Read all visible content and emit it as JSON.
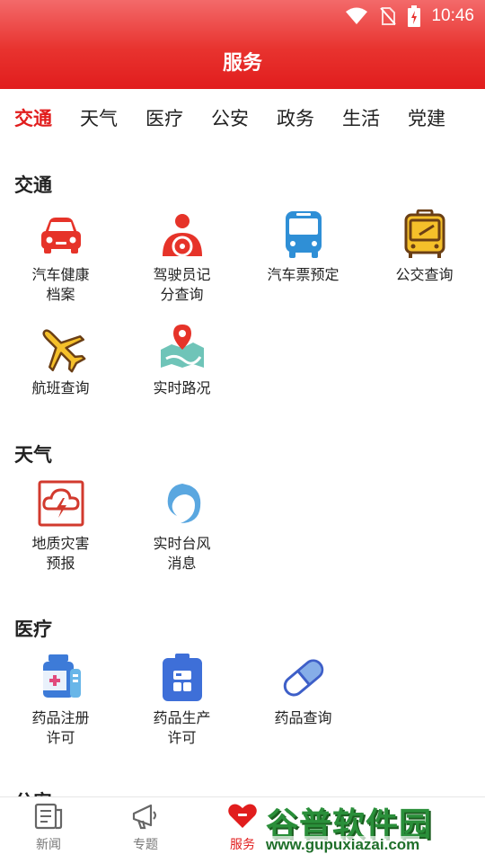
{
  "statusbar": {
    "time": "10:46"
  },
  "header": {
    "title": "服务"
  },
  "tabs": [
    {
      "label": "交通",
      "active": true
    },
    {
      "label": "天气"
    },
    {
      "label": "医疗"
    },
    {
      "label": "公安"
    },
    {
      "label": "政务"
    },
    {
      "label": "生活"
    },
    {
      "label": "党建"
    }
  ],
  "sections": {
    "traffic": {
      "title": "交通",
      "items": [
        {
          "label": "汽车健康\n档案",
          "icon": "car-icon"
        },
        {
          "label": "驾驶员记\n分查询",
          "icon": "driver-icon"
        },
        {
          "label": "汽车票预定",
          "icon": "bus-icon"
        },
        {
          "label": "公交查询",
          "icon": "bus-front-icon"
        },
        {
          "label": "航班查询",
          "icon": "airplane-icon"
        },
        {
          "label": "实时路况",
          "icon": "map-pin-icon"
        }
      ]
    },
    "weather": {
      "title": "天气",
      "items": [
        {
          "label": "地质灾害\n预报",
          "icon": "storm-warning-icon"
        },
        {
          "label": "实时台风\n消息",
          "icon": "typhoon-icon"
        }
      ]
    },
    "medical": {
      "title": "医疗",
      "items": [
        {
          "label": "药品注册\n许可",
          "icon": "medicine-bottle-icon"
        },
        {
          "label": "药品生产\n许可",
          "icon": "clipboard-icon"
        },
        {
          "label": "药品查询",
          "icon": "pill-icon"
        }
      ]
    },
    "police_peek": {
      "title": "公安"
    }
  },
  "bottomnav": [
    {
      "label": "新闻",
      "icon": "news-icon"
    },
    {
      "label": "专题",
      "icon": "megaphone-icon"
    },
    {
      "label": "服务",
      "icon": "heart-icon",
      "active": true
    }
  ],
  "watermark": {
    "text": "谷普软件园",
    "url": "www.gupuxiazai.com"
  },
  "colors": {
    "accent": "#e11d1d",
    "header_gradient_top": "#f36a6a"
  }
}
